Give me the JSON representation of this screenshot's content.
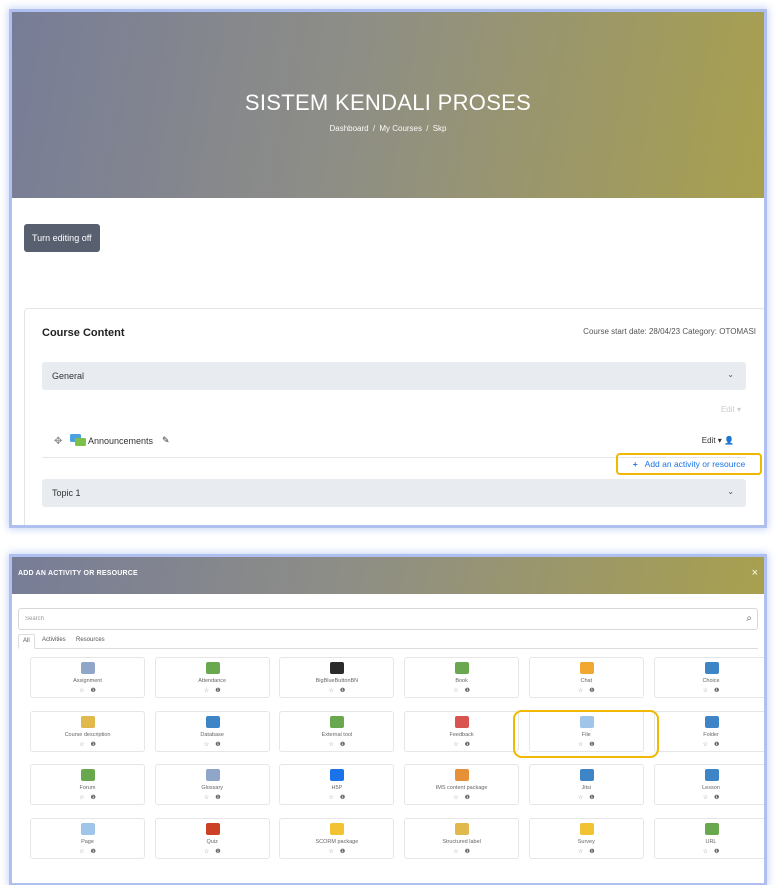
{
  "header": {
    "title": "SISTEM KENDALI PROSES",
    "breadcrumb": [
      "Dashboard",
      "My Courses",
      "Skp"
    ],
    "breadcrumb_sep": "/"
  },
  "editing_button": "Turn editing off",
  "course": {
    "heading": "Course Content",
    "meta": "Course start date: 28/04/23  Category: OTOMASI",
    "general_section": "General",
    "faint_edit": "Edit",
    "activity_name": "Announcements",
    "edit_menu": "Edit",
    "add_button": "Add an activity or resource",
    "topic_section": "Topic 1"
  },
  "modal": {
    "title": "ADD AN ACTIVITY OR RESOURCE",
    "close_glyph": "×",
    "search_placeholder": "Search",
    "tabs": [
      "All",
      "Activities",
      "Resources"
    ],
    "tiles": [
      {
        "name": "Assignment",
        "icon": "assignment-icon",
        "color": "#8fa6c9"
      },
      {
        "name": "Attendance",
        "icon": "attendance-icon",
        "color": "#6aa84f"
      },
      {
        "name": "BigBlueButtonBN",
        "icon": "bigbluebutton-icon",
        "color": "#2b2b2b"
      },
      {
        "name": "Book",
        "icon": "book-icon",
        "color": "#6aa84f"
      },
      {
        "name": "Chat",
        "icon": "chat-icon",
        "color": "#f0a830"
      },
      {
        "name": "Choice",
        "icon": "choice-icon",
        "color": "#3d85c6"
      },
      {
        "name": "Course description",
        "icon": "course-description-icon",
        "color": "#e0b84c"
      },
      {
        "name": "Database",
        "icon": "database-icon",
        "color": "#3d85c6"
      },
      {
        "name": "External tool",
        "icon": "external-tool-icon",
        "color": "#6aa84f"
      },
      {
        "name": "Feedback",
        "icon": "feedback-icon",
        "color": "#d9534f"
      },
      {
        "name": "File",
        "icon": "file-icon",
        "color": "#9fc5e8"
      },
      {
        "name": "Folder",
        "icon": "folder-icon",
        "color": "#3d85c6"
      },
      {
        "name": "Forum",
        "icon": "forum-icon",
        "color": "#6aa84f"
      },
      {
        "name": "Glossary",
        "icon": "glossary-icon",
        "color": "#8fa6c9"
      },
      {
        "name": "H5P",
        "icon": "h5p-icon",
        "color": "#1a73e8"
      },
      {
        "name": "IMS content package",
        "icon": "ims-package-icon",
        "color": "#e69138"
      },
      {
        "name": "Jitsi",
        "icon": "jitsi-icon",
        "color": "#3d85c6"
      },
      {
        "name": "Lesson",
        "icon": "lesson-icon",
        "color": "#3d85c6"
      },
      {
        "name": "Page",
        "icon": "page-icon",
        "color": "#9fc5e8"
      },
      {
        "name": "Quiz",
        "icon": "quiz-icon",
        "color": "#cc4125"
      },
      {
        "name": "SCORM package",
        "icon": "scorm-icon",
        "color": "#f1c232"
      },
      {
        "name": "Structured label",
        "icon": "structured-label-icon",
        "color": "#e0b84c"
      },
      {
        "name": "Survey",
        "icon": "survey-icon",
        "color": "#f1c232"
      },
      {
        "name": "URL",
        "icon": "url-icon",
        "color": "#6aa84f"
      }
    ],
    "star_glyph": "☆",
    "info_glyph": "❶"
  },
  "colors": {
    "highlight": "#f0b800",
    "link": "#1a73e8",
    "dark_button": "#586070"
  }
}
